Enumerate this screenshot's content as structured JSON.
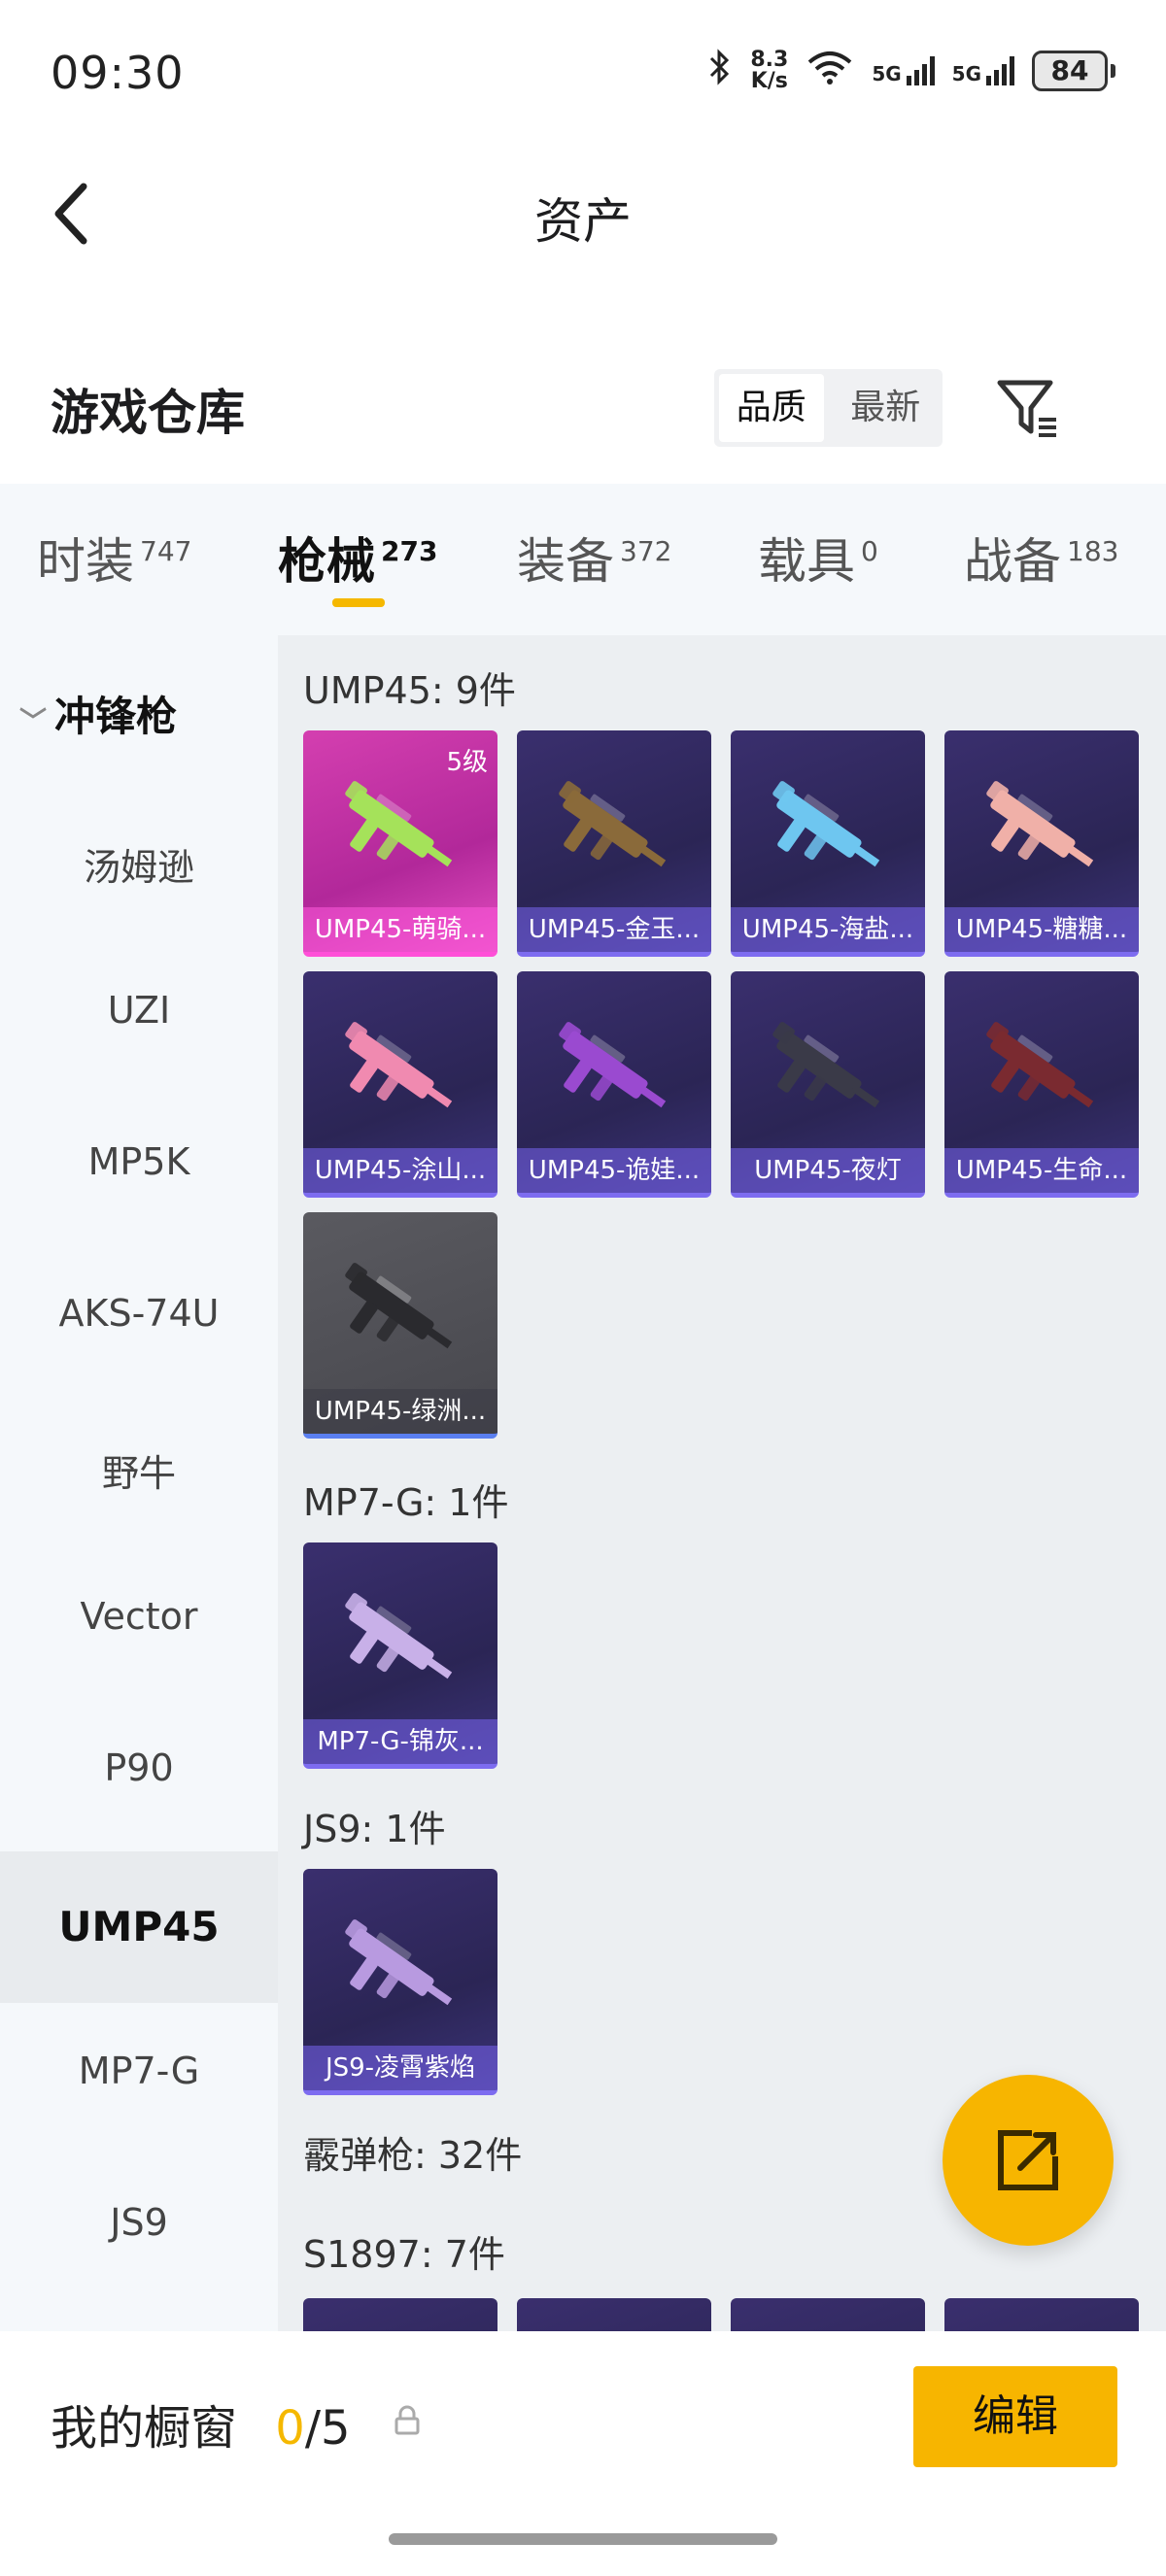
{
  "status": {
    "time": "09:30",
    "speed": [
      "8.3",
      "K/s"
    ],
    "network1": "5G",
    "network2": "5G",
    "battery": "84"
  },
  "header": {
    "title": "资产"
  },
  "warehouse": {
    "title": "游戏仓库",
    "sort_options": [
      "品质",
      "最新"
    ],
    "sort_active": "品质"
  },
  "tabs": [
    {
      "label": "时装",
      "count": "747"
    },
    {
      "label": "枪械",
      "count": "273"
    },
    {
      "label": "装备",
      "count": "372"
    },
    {
      "label": "载具",
      "count": "0"
    },
    {
      "label": "战备",
      "count": "183"
    }
  ],
  "sidebar": {
    "category": "冲锋枪",
    "items": [
      "汤姆逊",
      "UZI",
      "MP5K",
      "AKS-74U",
      "野牛",
      "Vector",
      "P90",
      "UMP45",
      "MP7-G",
      "JS9"
    ],
    "active": "UMP45"
  },
  "groups": [
    {
      "label": "UMP45: 9件",
      "items": [
        {
          "name": "UMP45-萌骑...",
          "tier": "pink",
          "badge": "5级",
          "gun_color": "#a5e25a"
        },
        {
          "name": "UMP45-金玉...",
          "tier": "purple",
          "gun_color": "#8a6a3a"
        },
        {
          "name": "UMP45-海盐...",
          "tier": "purple",
          "gun_color": "#6ec6f0"
        },
        {
          "name": "UMP45-糖糖...",
          "tier": "purple",
          "gun_color": "#f0b0a8"
        },
        {
          "name": "UMP45-涂山...",
          "tier": "purple",
          "gun_color": "#f08ab0"
        },
        {
          "name": "UMP45-诡娃...",
          "tier": "purple",
          "gun_color": "#9a4ad0"
        },
        {
          "name": "UMP45-夜灯",
          "tier": "purple",
          "gun_color": "#3a3a48"
        },
        {
          "name": "UMP45-生命...",
          "tier": "purple",
          "gun_color": "#7a2a30"
        },
        {
          "name": "UMP45-绿洲...",
          "tier": "gray",
          "gun_color": "#2a2a2e"
        }
      ]
    },
    {
      "label": "MP7-G: 1件",
      "items": [
        {
          "name": "MP7-G-锦灰...",
          "tier": "purple",
          "gun_color": "#c8b0e8"
        }
      ]
    },
    {
      "label": "JS9: 1件",
      "items": [
        {
          "name": "JS9-凌霄紫焰",
          "tier": "purple",
          "gun_color": "#b89ae0"
        }
      ]
    }
  ],
  "shotgun_label": "霰弹枪: 32件",
  "s1897_label": "S1897: 7件",
  "bottom": {
    "showcase": "我的橱窗",
    "count_now": "0",
    "count_sep_total": "/5",
    "edit_label": "编辑"
  },
  "colors": {
    "accent": "#f7b500",
    "purple_tier": "#7d6cf0",
    "pink_tier": "#ff4fd8"
  }
}
